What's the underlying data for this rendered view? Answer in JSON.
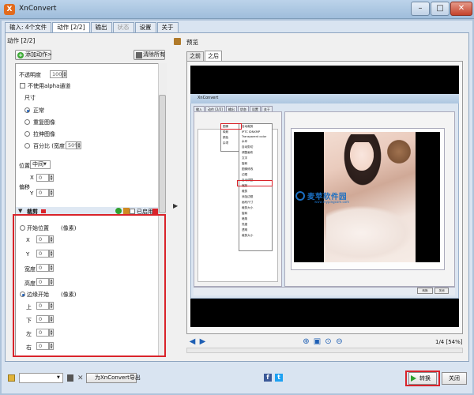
{
  "window": {
    "title": "XnConvert",
    "min": "–",
    "max": "□",
    "close": "✕"
  },
  "main_tabs": [
    {
      "label": "输入: 4个文件",
      "state": "normal"
    },
    {
      "label": "动作 [2/2]",
      "state": "active"
    },
    {
      "label": "输出",
      "state": "normal"
    },
    {
      "label": "状态",
      "state": "disabled"
    },
    {
      "label": "设置",
      "state": "normal"
    },
    {
      "label": "关于",
      "state": "normal"
    }
  ],
  "actions": {
    "label": "动作 [2/2]",
    "add_button": "添加动作>",
    "clear_button": "清除所有",
    "opacity_label": "不透明度",
    "opacity_value": "100",
    "no_alpha_label": "不使用alpha通道",
    "size_label": "尺寸",
    "size_options": [
      {
        "label": "正常",
        "selected": true
      },
      {
        "label": "重复图像",
        "selected": false
      },
      {
        "label": "拉伸图像",
        "selected": false
      },
      {
        "label": "百分比 (宽度)",
        "selected": false
      }
    ],
    "percent_value": "50%",
    "position_label": "位置",
    "position_value": "中间",
    "offset_label": "偏移",
    "x_label": "X",
    "y_label": "Y",
    "x_value": "0",
    "y_value": "0",
    "crop_title": "裁剪",
    "enabled_label": "已启用",
    "start_position_label": "开始位置",
    "pixel_label": "(像素)",
    "x2_label": "X",
    "y2_label": "Y",
    "width_label": "宽度",
    "height_label": "高度",
    "field_zero": "0",
    "from_edge_label": "边缘开始",
    "pixel_label2": "(像素)",
    "top_label": "上",
    "bottom_label": "下",
    "left_label": "左",
    "right_label": "右"
  },
  "preview": {
    "label": "预览",
    "tab_before": "之前",
    "tab_after": "之后",
    "page_info": "1/4 [54%]"
  },
  "inner_screenshot": {
    "title": "XnConvert",
    "tabs": [
      "输入",
      "动作 [2/2]",
      "输出",
      "状态",
      "设置",
      "关于"
    ],
    "menu_items": [
      "图像",
      "映射",
      "颜色",
      "杂项"
    ],
    "submenu_items": [
      "自动裁剪",
      "IPTC IDNXMP",
      "Transparent color",
      "水印",
      "自动剪切",
      "调整画布",
      "文字",
      "旋转",
      "图像修改",
      "边框",
      "自动调整",
      "缩放",
      "裁剪",
      "添加边框",
      "画布尺寸",
      "裁剪大小",
      "旋转",
      "暗角",
      "亮度",
      "透明",
      "裁剪大小"
    ],
    "watermark": "麦苹软件园",
    "watermark_url": "www.mypingcom.com",
    "convert": "转换",
    "close": "关闭"
  },
  "bottom": {
    "export_button": "为XnConvert导出",
    "convert_button": "转换",
    "close_button": "关闭",
    "facebook": "f",
    "twitter": "t"
  },
  "colors": {
    "highlight_red": "#d9232a",
    "frame_blue": "#d9e4f1",
    "watermark_blue": "#1b6fc2"
  }
}
